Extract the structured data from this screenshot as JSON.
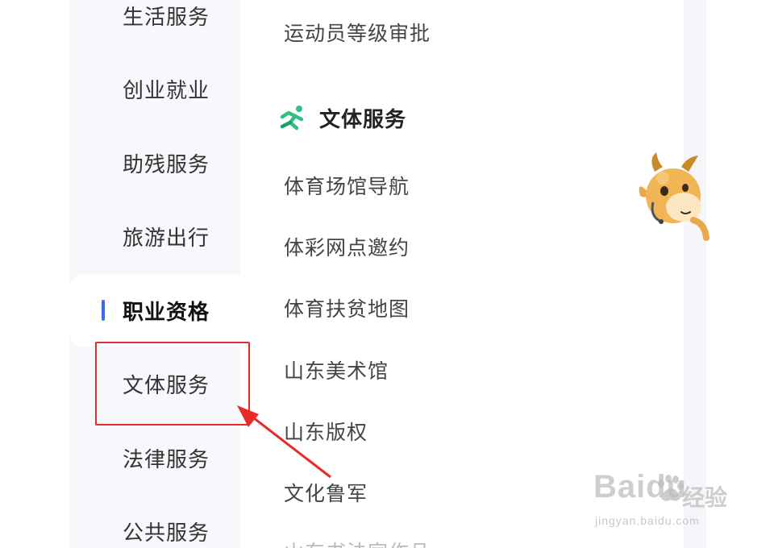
{
  "sidebar": {
    "items": [
      {
        "label": "生活服务",
        "active": false
      },
      {
        "label": "创业就业",
        "active": false
      },
      {
        "label": "助残服务",
        "active": false
      },
      {
        "label": "旅游出行",
        "active": false
      },
      {
        "label": "职业资格",
        "active": true
      },
      {
        "label": "文体服务",
        "active": false
      },
      {
        "label": "法律服务",
        "active": false
      },
      {
        "label": "公共服务",
        "active": false
      }
    ]
  },
  "content": {
    "top_link": "运动员等级审批",
    "section": {
      "icon": "running-person-icon",
      "title": "文体服务",
      "links": [
        "体育场馆导航",
        "体彩网点邀约",
        "体育扶贫地图",
        "山东美术馆",
        "山东版权",
        "文化鲁军"
      ],
      "next_partial": "山东书法家作品"
    }
  },
  "annotation": {
    "color": "#e82a2a",
    "target": "文体服务"
  },
  "colors": {
    "accent": "#3b6cf6",
    "section_icon": "#2fc083",
    "annotation": "#e82a2a"
  },
  "watermark": {
    "logo": "Baidu",
    "cn": "经验",
    "url": "jingyan.baidu.com"
  }
}
